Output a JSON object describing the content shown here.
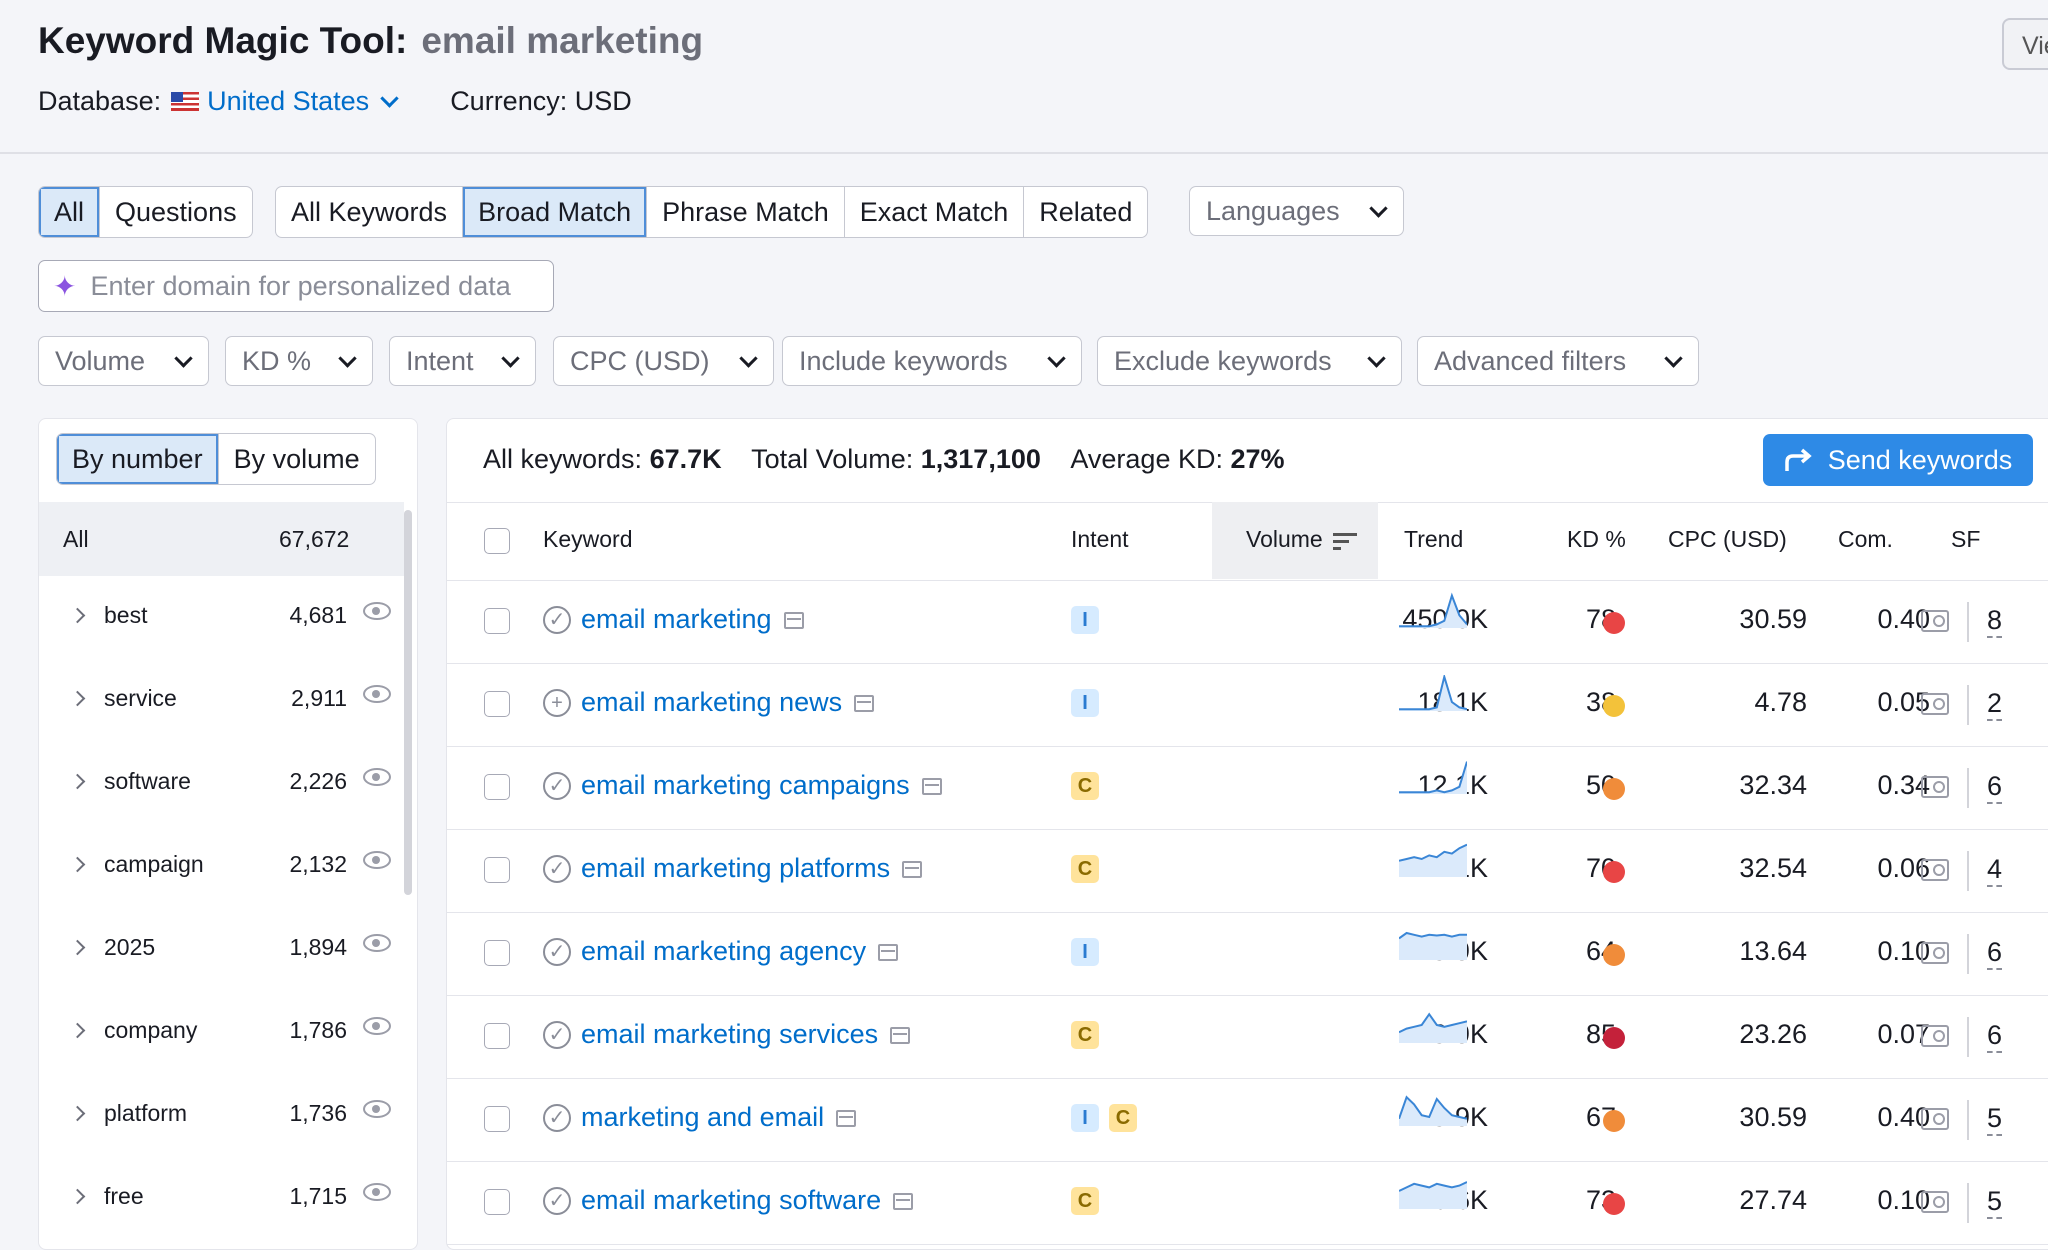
{
  "header": {
    "title": "Keyword Magic Tool:",
    "query": "email marketing",
    "database_label": "Database:",
    "database_value": "United States",
    "currency": "Currency: USD",
    "view_button": "Vie"
  },
  "tabs": {
    "scope": [
      "All",
      "Questions"
    ],
    "match": [
      "All Keywords",
      "Broad Match",
      "Phrase Match",
      "Exact Match",
      "Related"
    ],
    "active_scope": "All",
    "active_match": "Broad Match",
    "languages": "Languages"
  },
  "domain_input": {
    "placeholder": "Enter domain for personalized data"
  },
  "filters": [
    "Volume",
    "KD %",
    "Intent",
    "CPC (USD)",
    "Include keywords",
    "Exclude keywords",
    "Advanced filters"
  ],
  "sidebar": {
    "toggle": [
      "By number",
      "By volume"
    ],
    "active_toggle": "By number",
    "all_label": "All",
    "all_count": "67,672",
    "groups": [
      {
        "label": "best",
        "count": "4,681"
      },
      {
        "label": "service",
        "count": "2,911"
      },
      {
        "label": "software",
        "count": "2,226"
      },
      {
        "label": "campaign",
        "count": "2,132"
      },
      {
        "label": "2025",
        "count": "1,894"
      },
      {
        "label": "company",
        "count": "1,786"
      },
      {
        "label": "platform",
        "count": "1,736"
      },
      {
        "label": "free",
        "count": "1,715"
      }
    ]
  },
  "summary": {
    "all_keywords_label": "All keywords:",
    "all_keywords_value": "67.7K",
    "total_volume_label": "Total Volume:",
    "total_volume_value": "1,317,100",
    "avg_kd_label": "Average KD:",
    "avg_kd_value": "27%"
  },
  "send_button": "Send keywords",
  "table": {
    "columns": [
      "Keyword",
      "Intent",
      "Volume",
      "Trend",
      "KD %",
      "CPC (USD)",
      "Com.",
      "SF"
    ],
    "rows": [
      {
        "keyword": "email marketing",
        "status": "check",
        "intent": [
          "I"
        ],
        "volume": "450.0K",
        "trend": [
          0.05,
          0.05,
          0.05,
          0.05,
          0.05,
          0.1,
          0.2,
          0.9,
          0.35,
          0.1
        ],
        "kd": "78",
        "kd_color": "#e84545",
        "cpc": "30.59",
        "com": "0.40",
        "sf": "8"
      },
      {
        "keyword": "email marketing news",
        "status": "plus",
        "intent": [
          "I"
        ],
        "volume": "18.1K",
        "trend": [
          0.05,
          0.05,
          0.05,
          0.05,
          0.05,
          0.1,
          0.95,
          0.25,
          0.1,
          0.05
        ],
        "kd": "38",
        "kd_color": "#f3c23a",
        "cpc": "4.78",
        "com": "0.05",
        "sf": "2"
      },
      {
        "keyword": "email marketing campaigns",
        "status": "check",
        "intent": [
          "C"
        ],
        "volume": "12.1K",
        "trend": [
          0.05,
          0.05,
          0.05,
          0.05,
          0.05,
          0.1,
          0.05,
          0.1,
          0.2,
          0.9
        ],
        "kd": "50",
        "kd_color": "#f08c3a",
        "cpc": "32.34",
        "com": "0.34",
        "sf": "6"
      },
      {
        "keyword": "email marketing platforms",
        "status": "check",
        "intent": [
          "C"
        ],
        "volume": "12.1K",
        "trend": [
          0.45,
          0.5,
          0.55,
          0.5,
          0.6,
          0.55,
          0.7,
          0.65,
          0.8,
          0.9
        ],
        "kd": "70",
        "kd_color": "#e84545",
        "cpc": "32.54",
        "com": "0.06",
        "sf": "4"
      },
      {
        "keyword": "email marketing agency",
        "status": "check",
        "intent": [
          "I"
        ],
        "volume": "9.9K",
        "trend": [
          0.6,
          0.75,
          0.7,
          0.65,
          0.7,
          0.68,
          0.7,
          0.65,
          0.7,
          0.7
        ],
        "kd": "64",
        "kd_color": "#f08c3a",
        "cpc": "13.64",
        "com": "0.10",
        "sf": "6"
      },
      {
        "keyword": "email marketing services",
        "status": "check",
        "intent": [
          "C"
        ],
        "volume": "9.9K",
        "trend": [
          0.3,
          0.4,
          0.45,
          0.5,
          0.8,
          0.5,
          0.45,
          0.5,
          0.55,
          0.6
        ],
        "kd": "85",
        "kd_color": "#c4213a",
        "cpc": "23.26",
        "com": "0.07",
        "sf": "6"
      },
      {
        "keyword": "marketing and email",
        "status": "check",
        "intent": [
          "I",
          "C"
        ],
        "volume": "9.9K",
        "trend": [
          0.2,
          0.8,
          0.6,
          0.3,
          0.25,
          0.75,
          0.5,
          0.3,
          0.25,
          0.2
        ],
        "kd": "67",
        "kd_color": "#f08c3a",
        "cpc": "30.59",
        "com": "0.40",
        "sf": "5"
      },
      {
        "keyword": "email marketing software",
        "status": "check",
        "intent": [
          "C"
        ],
        "volume": "6.6K",
        "trend": [
          0.5,
          0.6,
          0.7,
          0.65,
          0.6,
          0.7,
          0.65,
          0.6,
          0.65,
          0.75
        ],
        "kd": "73",
        "kd_color": "#e84545",
        "cpc": "27.74",
        "com": "0.10",
        "sf": "5"
      }
    ]
  }
}
